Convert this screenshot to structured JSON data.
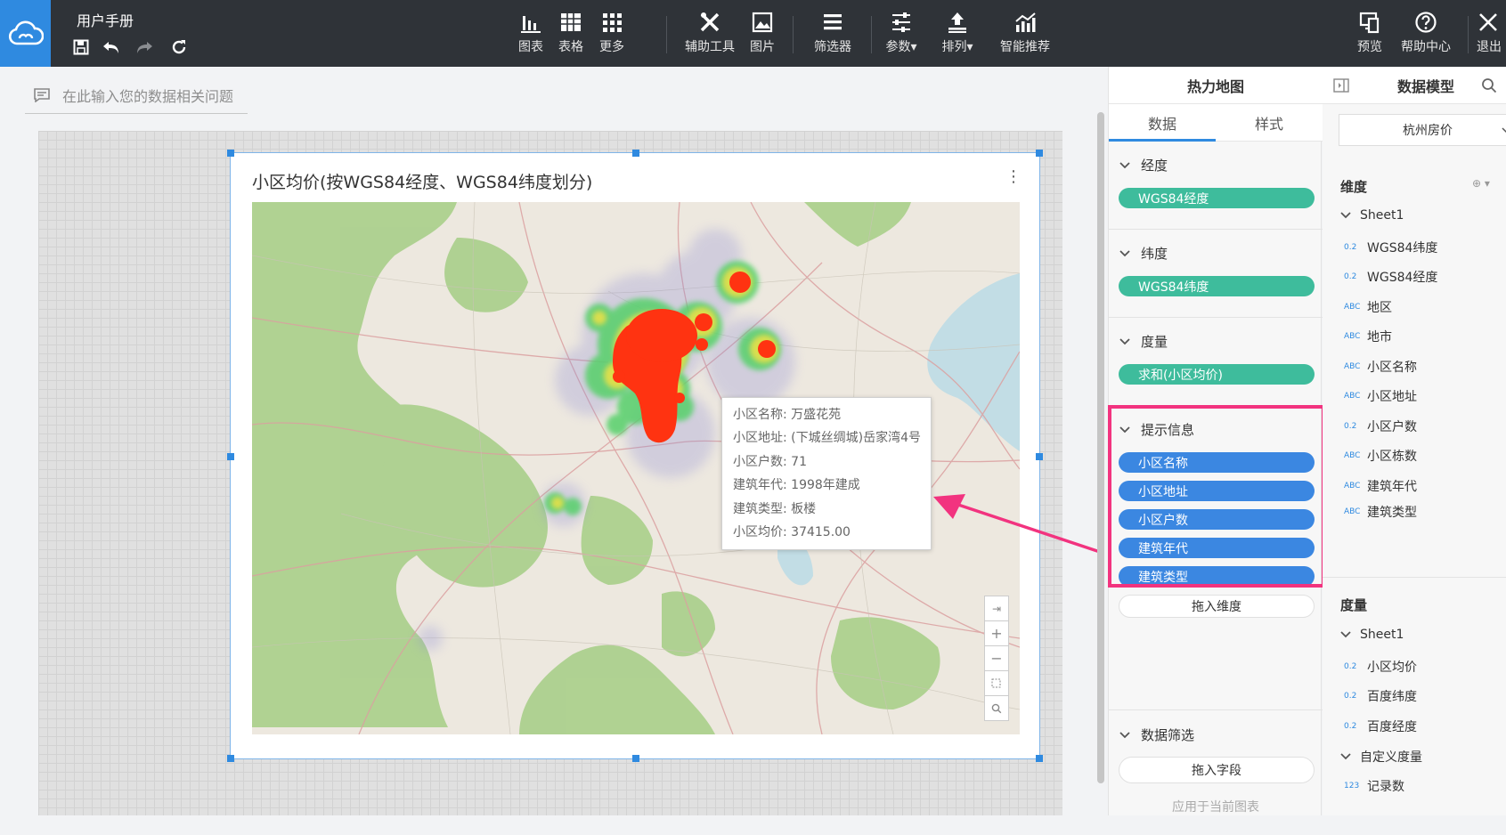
{
  "app": {
    "doc_title": "用户手册"
  },
  "toolbar": {
    "chart": "图表",
    "table": "表格",
    "more": "更多",
    "helper": "辅助工具",
    "image": "图片",
    "filter": "筛选器",
    "params": "参数",
    "sort": "排列",
    "smart": "智能推荐",
    "preview": "预览",
    "help": "帮助中心",
    "exit": "退出"
  },
  "query": {
    "placeholder": "在此输入您的数据相关问题"
  },
  "card": {
    "title": "小区均价(按WGS84经度、WGS84纬度划分)",
    "more_icon": "⋮"
  },
  "tooltip": {
    "lines": [
      "小区名称: 万盛花苑",
      "小区地址: (下城丝绸城)岳家湾4号",
      "小区户数: 71",
      "建筑年代: 1998年建成",
      "建筑类型: 板楼",
      "小区均价: 37415.00"
    ]
  },
  "map_controls": {
    "zoom_in": "+",
    "zoom_out": "−"
  },
  "panel1": {
    "title": "热力地图",
    "tabs": [
      "数据",
      "样式"
    ],
    "lon": {
      "header": "经度",
      "field": "WGS84经度"
    },
    "lat": {
      "header": "纬度",
      "field": "WGS84纬度"
    },
    "measure": {
      "header": "度量",
      "field": "求和(小区均价)"
    },
    "tooltip_sec": {
      "header": "提示信息",
      "fields": [
        "小区名称",
        "小区地址",
        "小区户数",
        "建筑年代",
        "建筑类型"
      ],
      "drop": "拖入维度"
    },
    "filter_sec": {
      "header": "数据筛选",
      "drop": "拖入字段",
      "apply": "应用于当前图表"
    }
  },
  "panel2": {
    "title": "数据模型",
    "dataset": "杭州房价",
    "dimensions": {
      "header": "维度",
      "sheet": "Sheet1",
      "fields": [
        {
          "type": "0.2",
          "name": "WGS84纬度"
        },
        {
          "type": "0.2",
          "name": "WGS84经度"
        },
        {
          "type": "ABC",
          "name": "地区"
        },
        {
          "type": "ABC",
          "name": "地市"
        },
        {
          "type": "ABC",
          "name": "小区名称"
        },
        {
          "type": "ABC",
          "name": "小区地址"
        },
        {
          "type": "0.2",
          "name": "小区户数"
        },
        {
          "type": "ABC",
          "name": "小区栋数"
        },
        {
          "type": "ABC",
          "name": "建筑年代"
        },
        {
          "type": "ABC",
          "name": "建筑类型"
        }
      ]
    },
    "measures": {
      "header": "度量",
      "sheet": "Sheet1",
      "fields": [
        {
          "type": "0.2",
          "name": "小区均价"
        },
        {
          "type": "0.2",
          "name": "百度纬度"
        },
        {
          "type": "0.2",
          "name": "百度经度"
        }
      ],
      "custom": "自定义度量",
      "custom_fields": [
        {
          "type": "123",
          "name": "记录数"
        }
      ]
    }
  },
  "colors": {
    "accent": "#2f8ae0",
    "green_pill": "#3ebc9c",
    "blue_pill": "#3b87e1",
    "highlight": "#f2337f"
  }
}
